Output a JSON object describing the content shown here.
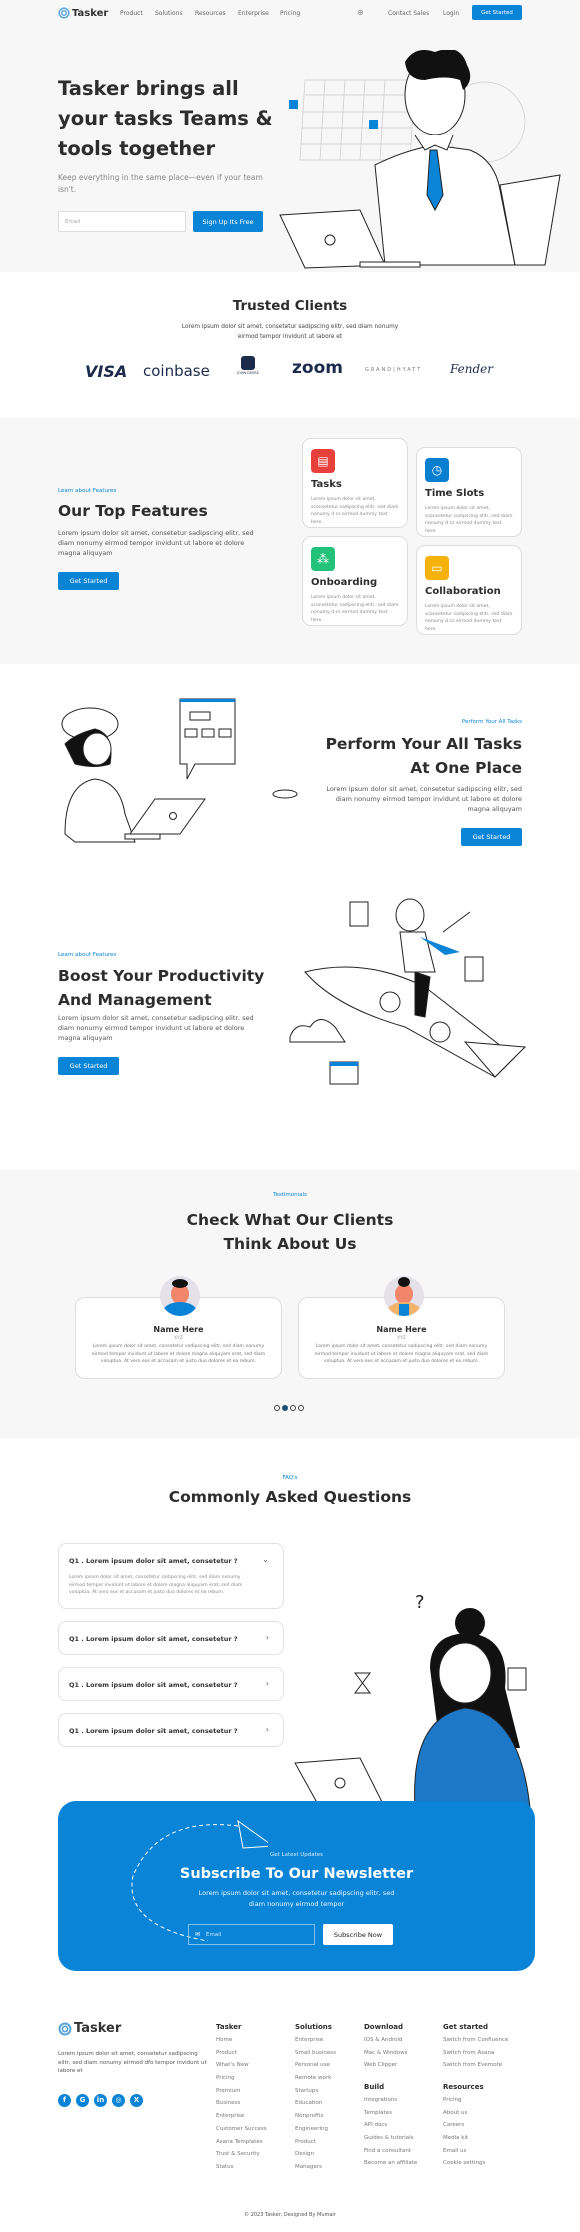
{
  "nav": {
    "brand": "Tasker",
    "links": [
      "Product",
      "Solutions",
      "Resources",
      "Enterprise",
      "Pricing"
    ],
    "contact_sales": "Contact Sales",
    "login": "Login",
    "cta": "Get Started"
  },
  "hero": {
    "title_lines": [
      "Tasker brings all",
      "your tasks Teams &",
      "tools together"
    ],
    "subtitle": "Keep everything in the same place—even if your team isn't.",
    "email_placeholder": "Email",
    "signup_button": "Sign Up Its Free"
  },
  "clients": {
    "title": "Trusted Clients",
    "description": "Lorem ipsum dolor sit amet, consetetur sadipscing elitr, sed diam nonumy eirmod tempor invidunt ut labore et",
    "logos": [
      "VISA",
      "coinbase",
      "JOHN DEERE",
      "zoom",
      "GRAND|HYATT",
      "Fender"
    ]
  },
  "features": {
    "label": "Learn about Features",
    "title": "Our Top Features",
    "description": "Lorem ipsum dolor sit amet, consetetur sadipscing elitr, sed diam nonumy eirmod tempor invidunt ut labore et dolore magna aliquyam",
    "button": "Get Started",
    "cards": [
      {
        "title": "Tasks",
        "desc": "Lorem ipsum dolor sit amet, sconsetetur sadipscing elitr, sed diam nonumy d cs eirmod dummy text here.",
        "color": "#e8403a",
        "icon": "clipboard-icon"
      },
      {
        "title": "Time Slots",
        "desc": "Lorem ipsum dolor sit amet, sconsetetur sadipscing elitr, sed diam nonumy d cs eirmod dummy text here.",
        "color": "#0a7fd0",
        "icon": "clock-icon"
      },
      {
        "title": "Onboarding",
        "desc": "Lorem ipsum dolor sit amet, sconsetetur sadipscing elitr, sed diam nonumy d cs eirmod dummy text here.",
        "color": "#22c27a",
        "icon": "network-icon"
      },
      {
        "title": "Collaboration",
        "desc": "Lorem ipsum dolor sit amet, sconsetetur sadipscing elitr, sed diam nonumy d cs eirmod dummy text here.",
        "color": "#f5b10c",
        "icon": "chat-icon"
      }
    ]
  },
  "perform": {
    "label": "Perform Your All Tasks",
    "title_lines": [
      "Perform Your All Tasks",
      "At One Place"
    ],
    "description": "Lorem ipsum dolor sit amet, consetetur sadipscing elitr, sed diam nonumy eirmod tempor invidunt ut labore et dolore magna aliquyam",
    "button": "Get Started"
  },
  "boost": {
    "label": "Learn about Features",
    "title_lines": [
      "Boost Your Productivity",
      "And Management"
    ],
    "description": "Lorem ipsum dolor sit amet, consetetur sadipscing elitr, sed diam nonumy eirmod tempor invidunt ut labore et dolore magna aliquyam",
    "button": "Get Started"
  },
  "testimonials": {
    "label": "Testimonials",
    "title_lines": [
      "Check What Our Clients",
      "Think About Us"
    ],
    "items": [
      {
        "name": "Name Here",
        "role": "XYZ",
        "text": "Lorem ipsum dolor sit amet, consetetur sadipscing elitr, sed diam nonumy eirmod tempor invidunt ut labore et dolore magna aliquyam erat, sed diam voluptua. At vero eos et accusam et justo duo dolores et ea rebum."
      },
      {
        "name": "Name Here",
        "role": "XYZ",
        "text": "Lorem ipsum dolor sit amet, consetetur sadipscing elitr, sed diam nonumy eirmod tempor invidunt ut labore et dolore magna aliquyam erat, sed diam voluptua. At vero eos et accusam et justo duo dolores et ea rebum."
      }
    ],
    "pagination": {
      "total": 4,
      "active": 2
    }
  },
  "faq": {
    "label": "FAQ's",
    "title": "Commonly Asked Questions",
    "items": [
      {
        "q": "Q1 . Lorem ipsum dolor sit amet, consetetur ?",
        "a": "Lorem ipsum dolor sit amet, consetetur sadipscing elitr, sed diam nonumy eirmod tempor invidunt ut labore et dolore magna aliquyam erat, sed diam voluptua. At vero eos et accusam et justo duo dolores et ea rebum.",
        "open": true
      },
      {
        "q": "Q1 . Lorem ipsum dolor sit amet, consetetur ?",
        "open": false
      },
      {
        "q": "Q1 . Lorem ipsum dolor sit amet, consetetur ?",
        "open": false
      },
      {
        "q": "Q1 . Lorem ipsum dolor sit amet, consetetur ?",
        "open": false
      }
    ]
  },
  "newsletter": {
    "label": "Get Latest Updates",
    "title": "Subscribe To Our Newsletter",
    "description": "Lorem ipsum dolor sit amet, consetetur sadipscing elitr, sed diam nonumy eirmod tempor",
    "email_placeholder": "Email",
    "button": "Subscribe Now"
  },
  "footer": {
    "brand": "Tasker",
    "about": "Lorem ipsum dolor sit amet, consetetur sadipscing elitr, sed diam nonumy eirmod dfo tempor invidunt ut labore et",
    "social": [
      "f",
      "G",
      "in",
      "◎",
      "X"
    ],
    "columns": [
      {
        "title": "Tasker",
        "links": [
          "Home",
          "Product",
          "What's New",
          "Pricing",
          "Premium",
          "Business",
          "Enterprise",
          "Customer Success",
          "Asana Templates",
          "Trust & Security",
          "Status"
        ]
      },
      {
        "title": "Solutions",
        "links": [
          "Enterprise",
          "Small business",
          "Personal use",
          "Remote work",
          "Startups",
          "Education",
          "Nonprofits",
          "Engineering",
          "Product",
          "Design",
          "Managers"
        ]
      },
      {
        "title": "Download",
        "links": [
          "IOS & Android",
          "Mac & Windows",
          "Web Clipper"
        ]
      },
      {
        "title": "Build",
        "links": [
          "Integrations",
          "Templates",
          "API docs",
          "Guides & tutorials",
          "Find a consultant",
          "Become an affiliate"
        ]
      },
      {
        "title": "Get started",
        "links": [
          "Switch from Confluence",
          "Switch from Asana",
          "Switch from Evernote"
        ]
      },
      {
        "title": "Resources",
        "links": [
          "Pricing",
          "About us",
          "Careers",
          "Media kit",
          "Email us",
          "Cookie settings"
        ]
      }
    ],
    "copyright": "© 2023 Tasker, Designed By Mumair"
  },
  "colors": {
    "accent": "#0a84d6",
    "text": "#2d2d2d",
    "bg_gray": "#f7f7f8"
  }
}
